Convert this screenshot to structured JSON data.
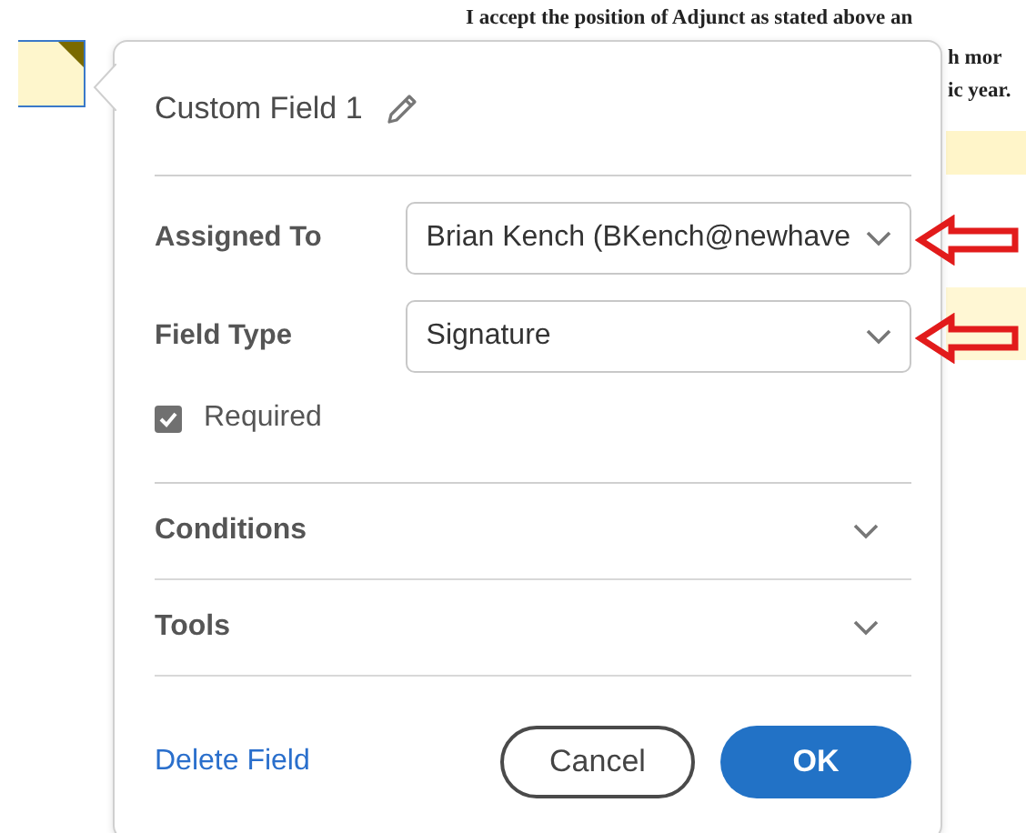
{
  "document": {
    "lines": [
      "I accept the position of Adjunct as stated above an",
      "h mor",
      "ic year."
    ]
  },
  "popover": {
    "title": "Custom Field 1",
    "fields": [
      {
        "label": "Assigned To",
        "value": "Brian Kench (BKench@newhave",
        "marked": true
      },
      {
        "label": "Field Type",
        "value": "Signature",
        "marked": true
      }
    ],
    "required": {
      "label": "Required",
      "checked": true
    },
    "sections": [
      {
        "label": "Conditions",
        "expanded": false
      },
      {
        "label": "Tools",
        "expanded": false
      }
    ],
    "delete_link": "Delete Field",
    "buttons": [
      {
        "label": "Cancel",
        "kind": "secondary"
      },
      {
        "label": "OK",
        "kind": "primary"
      }
    ]
  }
}
